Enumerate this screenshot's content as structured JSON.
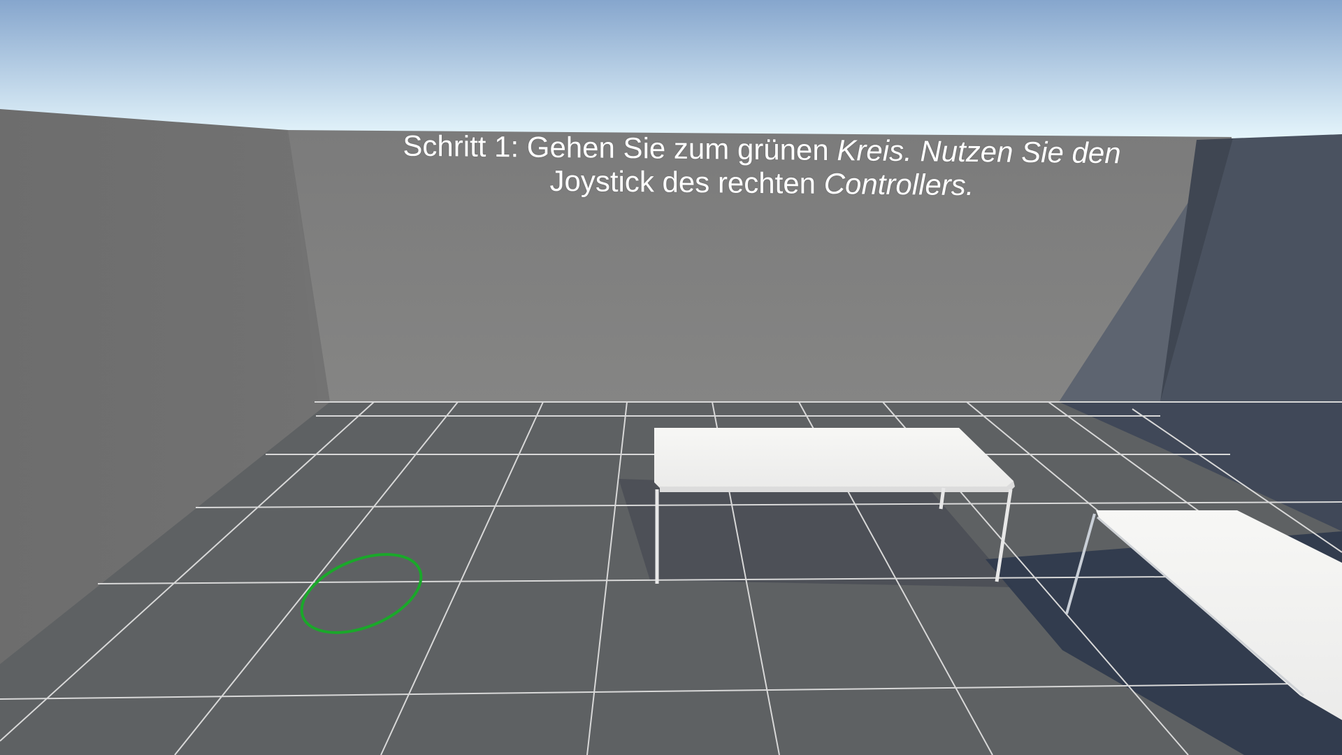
{
  "instruction": {
    "line1_a": "Schritt 1: Gehen Sie zum grünen",
    "line1_b": "Kreis. Nutzen Sie den",
    "line2_a": "Joystick des rechten",
    "line2_b": "Controllers."
  },
  "colors": {
    "sky_top": "#89a9cf",
    "sky_bottom": "#e3f4fb",
    "back_wall": "#808080",
    "left_wall": "#6b6b6b",
    "right_wall": "#4a5260",
    "floor": "#5e6163",
    "grid_line": "#d9d9d9",
    "target_ring": "#1aa82a",
    "table": "#f2f2f0"
  },
  "objects": {
    "target": "green-circle-target",
    "table_1": "white-table",
    "table_2": "white-table"
  }
}
